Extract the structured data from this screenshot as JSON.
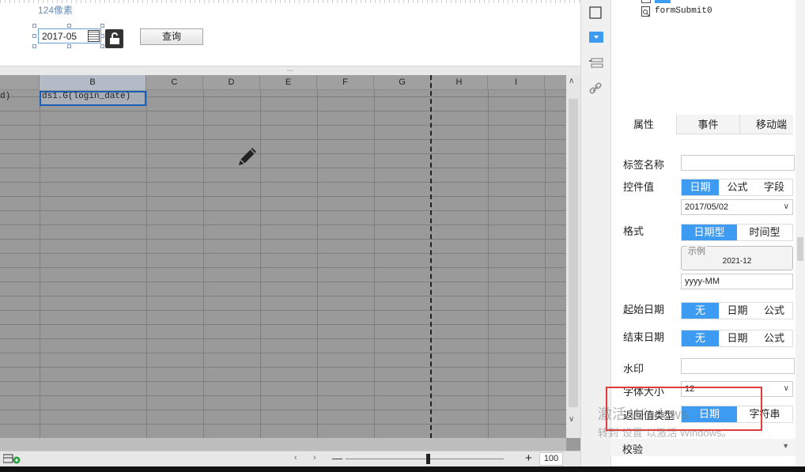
{
  "param_panel": {
    "size_label": "124像素",
    "date_value": "2017-05",
    "query_label": "查询",
    "splitter_dots": "..."
  },
  "sheet": {
    "columns": [
      "B",
      "C",
      "D",
      "E",
      "F",
      "G",
      "H",
      "I"
    ],
    "cell_a1": "d)",
    "cell_b1": "ds1.G(login_date)"
  },
  "status": {
    "zoom_value": "100",
    "zoom_minus": "—",
    "zoom_plus": "+"
  },
  "right_panel": {
    "tree_item": "formSubmit0",
    "tabs": [
      "属性",
      "事件",
      "移动端"
    ],
    "label_name": "标签名称",
    "control_value": "控件值",
    "control_value_opts": [
      "日期",
      "公式",
      "字段"
    ],
    "control_date": "2017/05/02",
    "format": "格式",
    "format_opts": [
      "日期型",
      "时间型"
    ],
    "sample_title": "示例",
    "sample_value": "2021-12",
    "format_pattern": "yyyy-MM",
    "start_date": "起始日期",
    "start_opts": [
      "无",
      "日期",
      "公式"
    ],
    "end_date": "结束日期",
    "end_opts": [
      "无",
      "日期",
      "公式"
    ],
    "watermark": "水印",
    "font_size": "字体大小",
    "font_size_value": "12",
    "return_type": "返回值类型",
    "return_opts": [
      "日期",
      "字符串"
    ],
    "verify": "校验"
  },
  "os_watermark": {
    "line1": "激活 Windows",
    "line2": "转到\"设置\"以激活 Windows。"
  },
  "colors": {
    "accent": "#3d9bf2",
    "highlight_box": "#e23b3b",
    "selection": "#1a5fb4"
  }
}
